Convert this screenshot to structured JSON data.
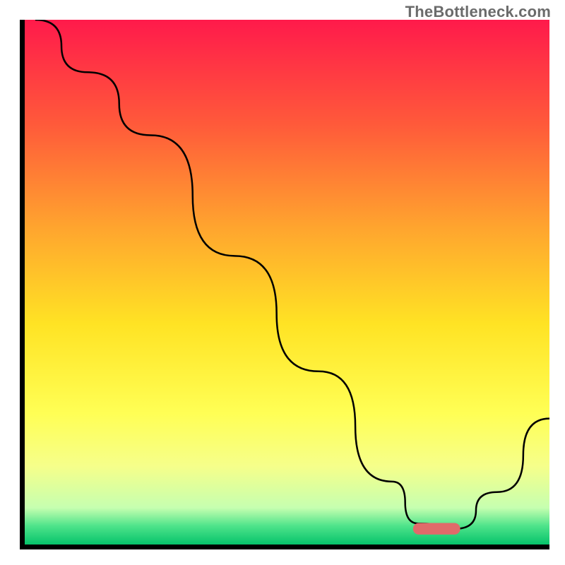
{
  "watermark": "TheBottleneck.com",
  "chart_data": {
    "type": "line",
    "title": "",
    "subtitle": "",
    "xlabel": "",
    "ylabel": "",
    "xlim": [
      0,
      100
    ],
    "ylim": [
      0,
      100
    ],
    "grid": false,
    "legend": false,
    "description": "Bottleneck curve over a red→yellow→green vertical gradient. Curve drops from top-left to a flat minimum around x≈75–82, then rises toward the right edge. A short rounded pink marker sits on the flat minimum.",
    "gradient_stops": [
      {
        "offset": 0.0,
        "color": "#ff1a4b"
      },
      {
        "offset": 0.2,
        "color": "#ff5a3a"
      },
      {
        "offset": 0.4,
        "color": "#ffa62e"
      },
      {
        "offset": 0.58,
        "color": "#ffe324"
      },
      {
        "offset": 0.75,
        "color": "#ffff55"
      },
      {
        "offset": 0.85,
        "color": "#f6ff8a"
      },
      {
        "offset": 0.93,
        "color": "#c6ffb0"
      },
      {
        "offset": 0.965,
        "color": "#4de38a"
      },
      {
        "offset": 1.0,
        "color": "#06c36b"
      }
    ],
    "series": [
      {
        "name": "bottleneck-curve",
        "color": "#000000",
        "stroke_width": 2.5,
        "x": [
          2,
          12,
          24,
          40,
          56,
          70,
          75,
          82,
          90,
          100
        ],
        "y": [
          100,
          90,
          78,
          55,
          33,
          12,
          4,
          3,
          10,
          24
        ]
      }
    ],
    "marker": {
      "name": "optimal-range-marker",
      "color": "#e06a6a",
      "x_start": 74,
      "x_end": 83,
      "y": 3,
      "height": 2.2,
      "rx": 1.1
    }
  }
}
